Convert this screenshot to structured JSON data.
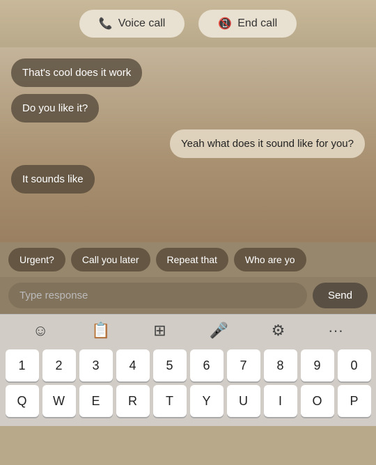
{
  "header": {
    "voice_call_label": "Voice call",
    "end_call_label": "End call"
  },
  "chat": {
    "messages": [
      {
        "id": 1,
        "text": "That's cool does it work",
        "side": "left"
      },
      {
        "id": 2,
        "text": "Do you like it?",
        "side": "left"
      },
      {
        "id": 3,
        "text": "Yeah what does it sound like for you?",
        "side": "right"
      },
      {
        "id": 4,
        "text": "It sounds like",
        "side": "left"
      }
    ],
    "quick_replies": [
      {
        "id": 1,
        "label": "Urgent?"
      },
      {
        "id": 2,
        "label": "Call you later"
      },
      {
        "id": 3,
        "label": "Repeat that"
      },
      {
        "id": 4,
        "label": "Who are yo"
      }
    ]
  },
  "input": {
    "placeholder": "Type response",
    "send_label": "Send"
  },
  "keyboard": {
    "number_row": [
      "1",
      "2",
      "3",
      "4",
      "5",
      "6",
      "7",
      "8",
      "9",
      "0"
    ],
    "top_row": [
      "Q",
      "W",
      "E",
      "R",
      "T",
      "Y",
      "U",
      "I",
      "O",
      "P"
    ]
  }
}
